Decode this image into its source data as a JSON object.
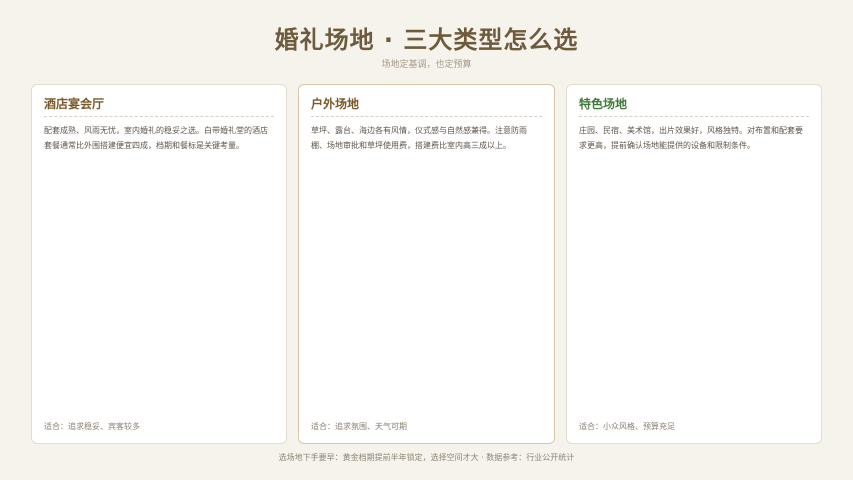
{
  "page": {
    "title": "婚礼场地 · 三大类型怎么选",
    "subtitle": "场地定基调，也定预算"
  },
  "cards": [
    {
      "title": "酒店宴会厅",
      "title_color": "#7a5a2c",
      "description": "配套成熟、风雨无忧，室内婚礼的稳妥之选。白带婚礼堂的酒店套餐通常比外围搭建便宜四成，档期和餐标是关键考量。",
      "fit": "适合：追求稳妥、宾客较多"
    },
    {
      "title": "户外场地",
      "title_color": "#7a5a2c",
      "description": "草坪、露台、海边各有风情，仪式感与自然感兼得。注意防雨棚、场地审批和草坪使用费，搭建费比室内高三成以上。",
      "fit": "适合：追求氛围、天气可期"
    },
    {
      "title": "特色场地",
      "title_color": "#3f7a3a",
      "description": "庄园、民宿、美术馆，出片效果好，风格独特。对布置和配套要求更高，提前确认场地能提供的设备和限制条件。",
      "fit": "适合：小众风格、预算充足"
    }
  ],
  "footer": {
    "text": "选场地下手要早：黄金档期提前半年锁定，选择空间才大 · 数据参考：行业公开统计"
  }
}
